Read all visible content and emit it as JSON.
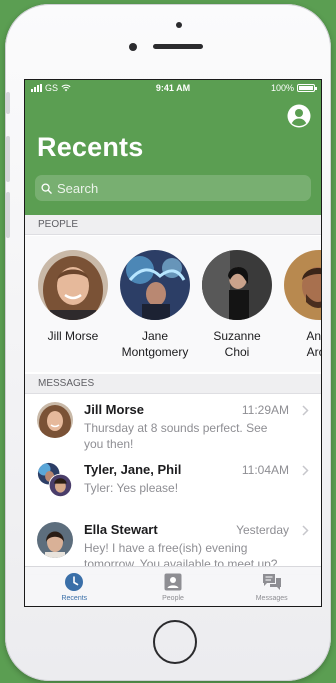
{
  "status_bar": {
    "carrier": "GS",
    "time": "9:41 AM",
    "battery": "100%"
  },
  "header": {
    "title": "Recents",
    "search_placeholder": "Search",
    "profile_icon": "person-circle-icon"
  },
  "people": {
    "section_label": "PEOPLE",
    "items": [
      {
        "line1": "Jill Morse",
        "line2": ""
      },
      {
        "line1": "Jane",
        "line2": "Montgomery"
      },
      {
        "line1": "Suzanne",
        "line2": "Choi"
      },
      {
        "line1": "Andr",
        "line2": "Arch"
      }
    ]
  },
  "messages": {
    "section_label": "MESSAGES",
    "items": [
      {
        "name": "Jill Morse",
        "time": "11:29AM",
        "text": "Thursday at 8 sounds perfect. See you then!"
      },
      {
        "name": "Tyler, Jane, Phil",
        "time": "11:04AM",
        "text": "Tyler: Yes please!"
      },
      {
        "name": "Ella Stewart",
        "time": "Yesterday",
        "text": "Hey! I have a free(ish) evening tomorrow. You available to meet up?"
      }
    ]
  },
  "tabbar": {
    "tabs": [
      {
        "label": "Recents",
        "icon": "clock-icon",
        "active": true
      },
      {
        "label": "People",
        "icon": "contact-card-icon",
        "active": false
      },
      {
        "label": "Messages",
        "icon": "chat-bubbles-icon",
        "active": false
      }
    ]
  },
  "colors": {
    "brand_green": "#5b9e52",
    "active_tab": "#3a6fa8",
    "muted_text": "#8e8e93"
  }
}
